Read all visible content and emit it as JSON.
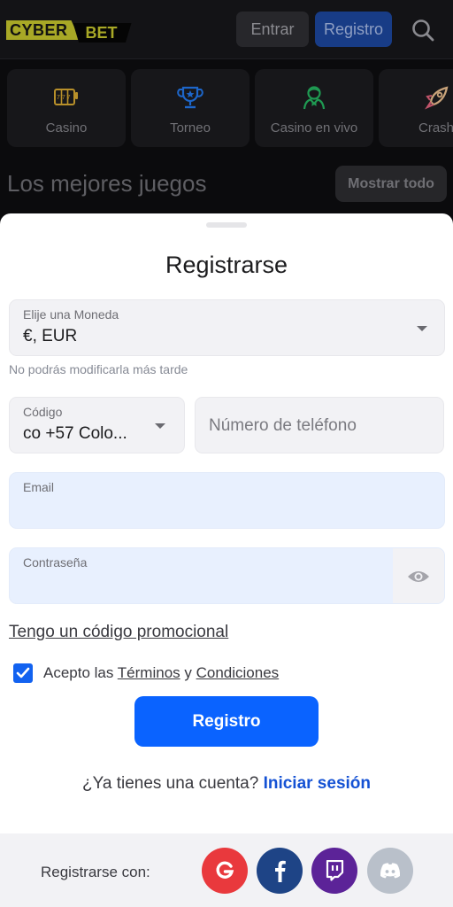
{
  "header": {
    "logo": {
      "part1": "CYBER",
      "part2": "BET"
    },
    "login_label": "Entrar",
    "register_label": "Registro",
    "search_icon": "search-icon"
  },
  "categories": [
    {
      "label": "Casino",
      "icon": "slot-machine-icon",
      "color": "#b8902a"
    },
    {
      "label": "Torneo",
      "icon": "trophy-icon",
      "color": "#1d66c9"
    },
    {
      "label": "Casino en vivo",
      "icon": "dealer-icon",
      "color": "#1f9a52"
    },
    {
      "label": "Crash",
      "icon": "rocket-icon",
      "color": "#c9a37a"
    }
  ],
  "section": {
    "title": "Los mejores juegos",
    "show_all_label": "Mostrar todo"
  },
  "signup": {
    "title": "Registrarse",
    "currency": {
      "label": "Elije una Moneda",
      "value": "€, EUR",
      "hint": "No podrás modificarla más tarde"
    },
    "phone_code": {
      "label": "Código",
      "value": "co +57 Colo..."
    },
    "phone": {
      "placeholder": "Número de teléfono",
      "value": ""
    },
    "email": {
      "label": "Email",
      "value": ""
    },
    "password": {
      "label": "Contraseña",
      "value": "",
      "toggle_icon": "eye-icon"
    },
    "promo_link": "Tengo un código promocional",
    "terms": {
      "checked": true,
      "prefix": "Acepto las ",
      "link1": "Términos",
      "middle": " y ",
      "link2": "Condiciones"
    },
    "submit_label": "Registro",
    "login_prompt": "¿Ya tienes una cuenta? ",
    "login_link": "Iniciar sesión"
  },
  "social": {
    "label": "Registrarse con:",
    "providers": [
      {
        "name": "Google",
        "color": "#e9393d"
      },
      {
        "name": "Facebook",
        "color": "#1e4486"
      },
      {
        "name": "Twitch",
        "color": "#5c2398"
      },
      {
        "name": "Discord",
        "color": "#b9c0ca"
      }
    ]
  },
  "colors": {
    "accent": "#0a63ff",
    "link": "#1552d4",
    "logo_yellow": "#a8a826"
  }
}
